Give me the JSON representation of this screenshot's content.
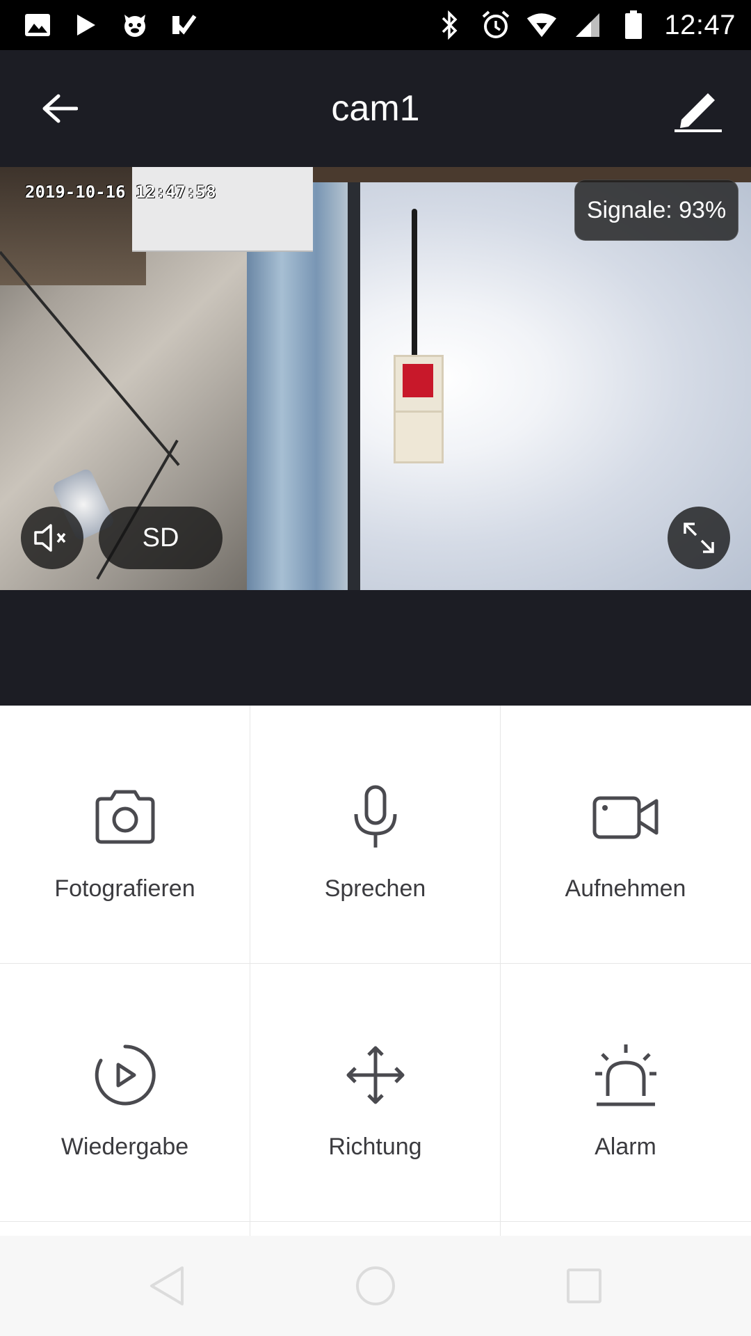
{
  "status_bar": {
    "time": "12:47",
    "left_icons": [
      "gallery-icon",
      "play-store-icon",
      "app-icon",
      "check-icon"
    ],
    "right_icons": [
      "bluetooth-icon",
      "alarm-icon",
      "wifi-icon",
      "cell-signal-icon",
      "battery-icon"
    ]
  },
  "app_bar": {
    "title": "cam1"
  },
  "video": {
    "timestamp": "2019-10-16 12:47:58",
    "signal_text": "Signale: 93%",
    "quality_label": "SD"
  },
  "actions": [
    {
      "label": "Fotografieren",
      "icon": "camera-icon"
    },
    {
      "label": "Sprechen",
      "icon": "microphone-icon"
    },
    {
      "label": "Aufnehmen",
      "icon": "video-camera-icon"
    },
    {
      "label": "Wiedergabe",
      "icon": "playback-icon"
    },
    {
      "label": "Richtung",
      "icon": "direction-arrows-icon"
    },
    {
      "label": "Alarm",
      "icon": "alarm-siren-icon"
    }
  ],
  "colors": {
    "appbar_bg": "#1c1d24",
    "icon_gray": "#4a4a4f",
    "label_gray": "#3b3b3f"
  }
}
